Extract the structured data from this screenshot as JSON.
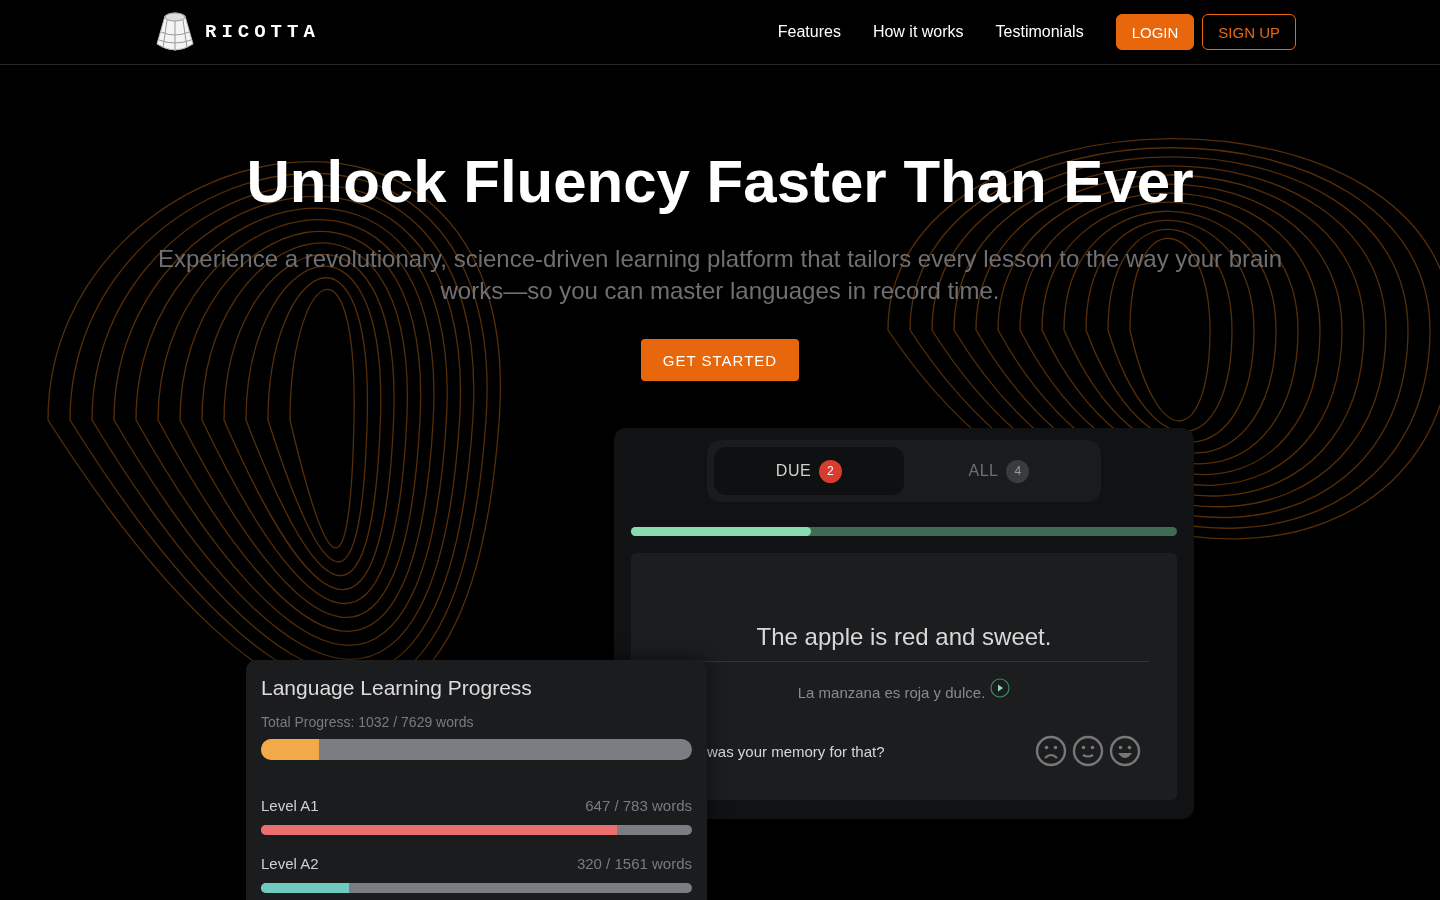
{
  "brand": "RICOTTA",
  "nav": {
    "links": [
      "Features",
      "How it works",
      "Testimonials"
    ],
    "login": "LOGIN",
    "signup": "SIGN UP"
  },
  "hero": {
    "title": "Unlock Fluency Faster Than Ever",
    "subtitle": "Experience a revolutionary, science-driven learning platform that tailors every lesson to the way your brain works—so you can master languages in record time.",
    "cta": "GET STARTED"
  },
  "flashcards": {
    "tabs": [
      {
        "label": "DUE",
        "count": "2",
        "selected": true
      },
      {
        "label": "ALL",
        "count": "4",
        "selected": false
      }
    ],
    "progress": {
      "level": 0.33
    },
    "prompt": "The apple is red and sweet.",
    "translation": "La manzana es roja y dulce.",
    "question": "was your memory for that?"
  },
  "progress_card": {
    "title": "Language Learning Progress",
    "total_label": "Total Progress: 1032 / 7629 words",
    "total": {
      "level": 0.135,
      "color": "#f2a94a"
    },
    "levels": [
      {
        "name": "Level A1",
        "count": "647 / 783 words",
        "level": 0.827,
        "color": "#ec6f6f"
      },
      {
        "name": "Level A2",
        "count": "320 / 1561 words",
        "level": 0.205,
        "color": "#6fcbbf"
      }
    ]
  }
}
